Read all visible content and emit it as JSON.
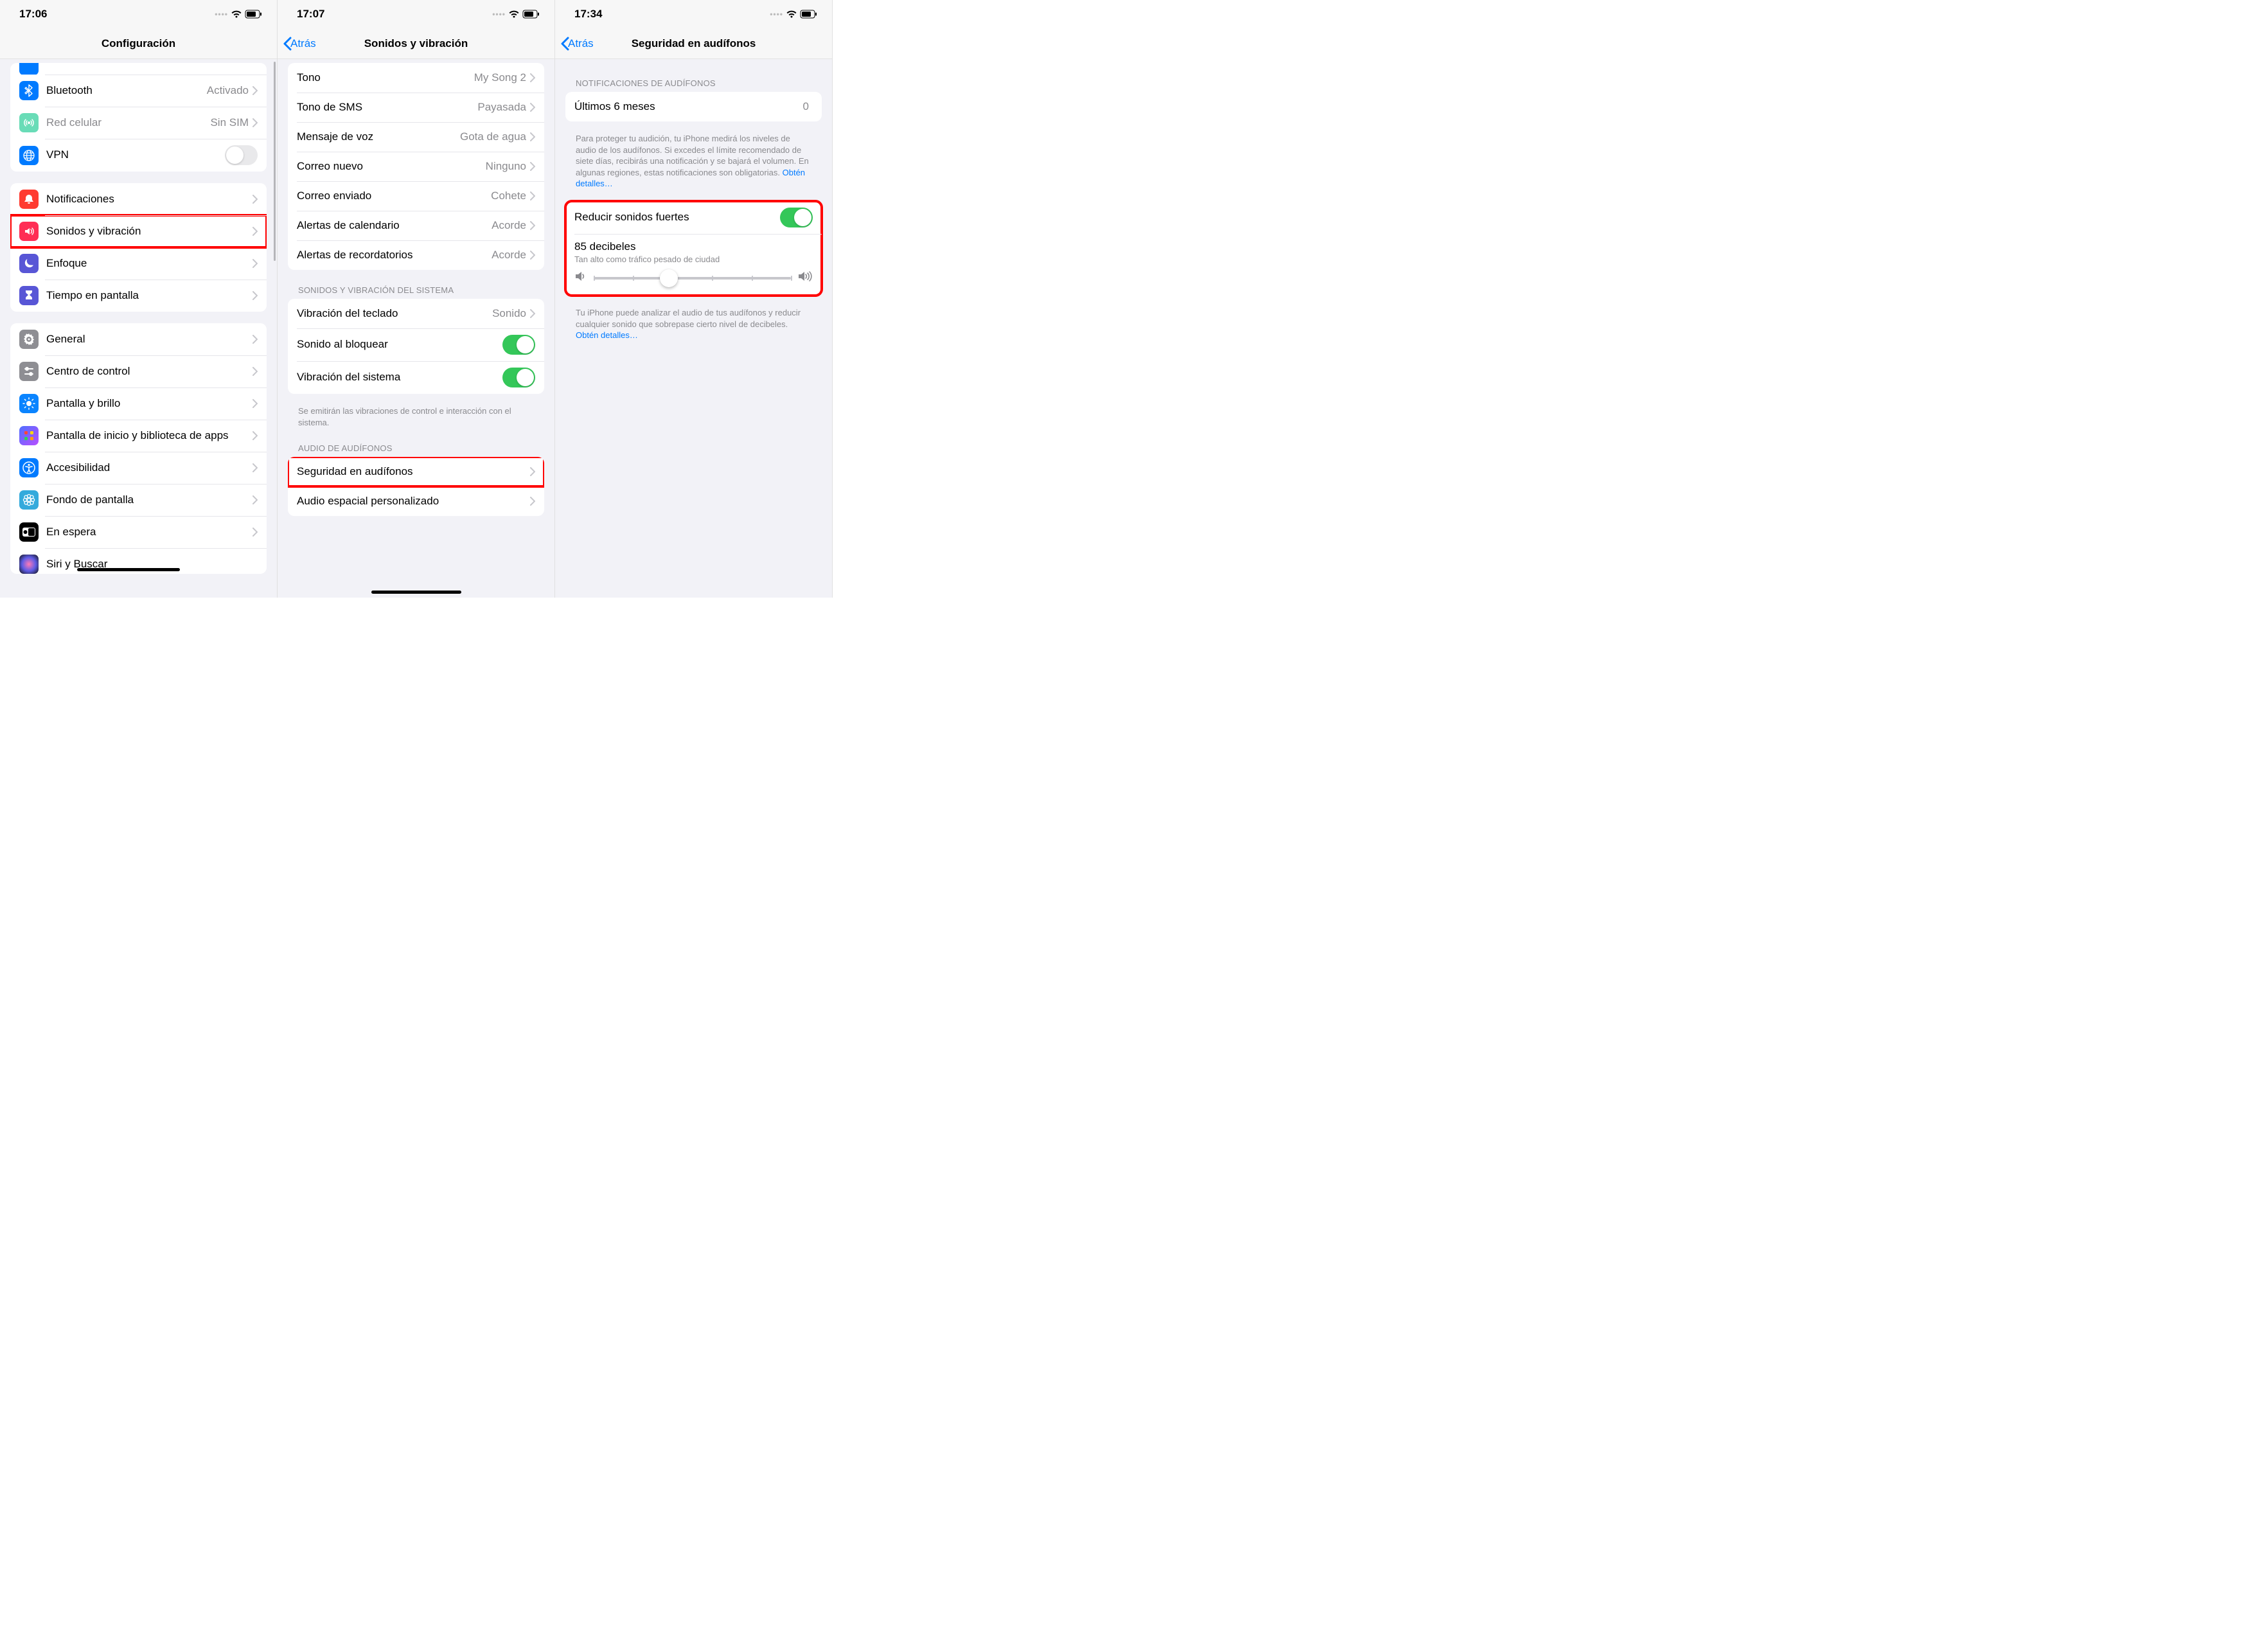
{
  "phone1": {
    "time": "17:06",
    "title": "Configuración",
    "connectivityGroup": [
      {
        "icon": "bluetooth",
        "bg": "#007aff",
        "label": "Bluetooth",
        "value": "Activado",
        "chevron": true
      },
      {
        "icon": "antenna",
        "bg": "#8ee2c5",
        "label": "Red celular",
        "value": "Sin SIM",
        "chevron": true
      },
      {
        "icon": "globe",
        "bg": "#007aff",
        "label": "VPN",
        "toggle": false
      }
    ],
    "mainGroup": [
      {
        "icon": "bell",
        "bg": "#ff3b30",
        "label": "Notificaciones"
      },
      {
        "icon": "speaker",
        "bg": "#ff2d55",
        "label": "Sonidos y vibración",
        "highlight": true
      },
      {
        "icon": "moon",
        "bg": "#5856d6",
        "label": "Enfoque"
      },
      {
        "icon": "hourglass",
        "bg": "#5856d6",
        "label": "Tiempo en pantalla"
      }
    ],
    "secondaryGroup": [
      {
        "icon": "gear",
        "bg": "#8e8e93",
        "label": "General"
      },
      {
        "icon": "switches",
        "bg": "#8e8e93",
        "label": "Centro de control"
      },
      {
        "icon": "sun",
        "bg": "#0a84ff",
        "label": "Pantalla y brillo"
      },
      {
        "icon": "grid",
        "bg": "#3557d6",
        "gradient": true,
        "label": "Pantalla de inicio y biblioteca de apps"
      },
      {
        "icon": "person",
        "bg": "#007aff",
        "label": "Accesibilidad"
      },
      {
        "icon": "flower",
        "bg": "#34aadc",
        "label": "Fondo de pantalla"
      },
      {
        "icon": "standby",
        "bg": "#000000",
        "label": "En espera"
      },
      {
        "icon": "siri",
        "bg": "#000000",
        "label": "Siri y Buscar"
      }
    ]
  },
  "phone2": {
    "time": "17:07",
    "back": "Atrás",
    "title": "Sonidos y vibración",
    "soundsGroup": [
      {
        "label": "Tono",
        "value": "My Song 2"
      },
      {
        "label": "Tono de SMS",
        "value": "Payasada"
      },
      {
        "label": "Mensaje de voz",
        "value": "Gota de agua"
      },
      {
        "label": "Correo nuevo",
        "value": "Ninguno"
      },
      {
        "label": "Correo enviado",
        "value": "Cohete"
      },
      {
        "label": "Alertas de calendario",
        "value": "Acorde"
      },
      {
        "label": "Alertas de recordatorios",
        "value": "Acorde"
      }
    ],
    "systemHeader": "SONIDOS Y VIBRACIÓN DEL SISTEMA",
    "systemGroup": [
      {
        "label": "Vibración del teclado",
        "value": "Sonido",
        "chevron": true
      },
      {
        "label": "Sonido al bloquear",
        "toggle": true
      },
      {
        "label": "Vibración del sistema",
        "toggle": true
      }
    ],
    "systemFooter": "Se emitirán las vibraciones de control e interacción con el sistema.",
    "headphoneHeader": "AUDIO DE AUDÍFONOS",
    "headphoneGroup": [
      {
        "label": "Seguridad en audífonos",
        "highlight": true
      },
      {
        "label": "Audio espacial personalizado"
      }
    ]
  },
  "phone3": {
    "time": "17:34",
    "back": "Atrás",
    "title": "Seguridad en audífonos",
    "notifHeader": "NOTIFICACIONES DE AUDÍFONOS",
    "last6": {
      "label": "Últimos 6 meses",
      "value": "0"
    },
    "notifFooter": "Para proteger tu audición, tu iPhone medirá los niveles de audio de los audífonos. Si excedes el límite recomendado de siete días, recibirás una notificación y se bajará el volumen. En algunas regiones, estas notificaciones son obligatorias.",
    "learnMore": "Obtén detalles…",
    "reduce": {
      "label": "Reducir sonidos fuertes",
      "on": true,
      "level": "85 decibeles",
      "desc": "Tan alto como tráfico pesado de ciudad",
      "sliderPos": 38
    },
    "reduceFooter": "Tu iPhone puede analizar el audio de tus audífonos y reducir cualquier sonido que sobrepase cierto nivel de decibeles.",
    "learnMore2": "Obtén detalles…"
  }
}
